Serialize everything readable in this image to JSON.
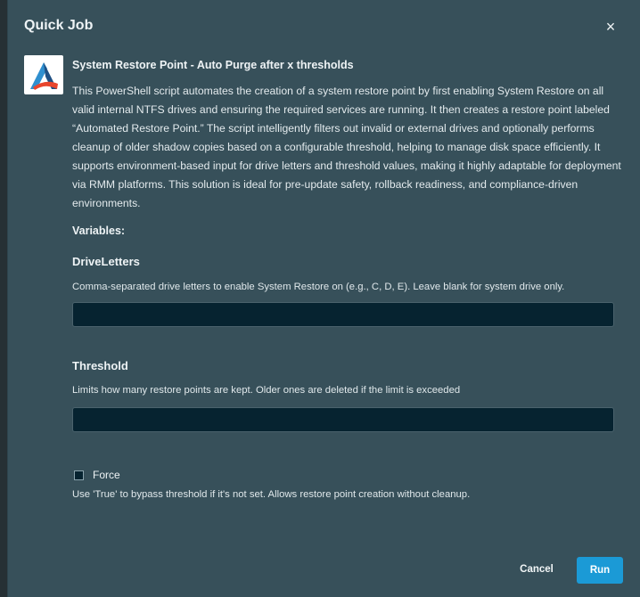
{
  "dialog": {
    "title": "Quick Job",
    "close_icon": "×"
  },
  "script": {
    "logo_icon": "ninjaone-logo",
    "title": "System Restore Point - Auto Purge after x thresholds",
    "description": "This PowerShell script automates the creation of a system restore point by first enabling System Restore on all valid internal NTFS drives and ensuring the required services are running. It then creates a restore point labeled “Automated Restore Point.” The script intelligently filters out invalid or external drives and optionally performs cleanup of older shadow copies based on a configurable threshold, helping to manage disk space efficiently. It supports environment-based input for drive letters and threshold values, making it highly adaptable for deployment via RMM platforms. This solution is ideal for pre-update safety, rollback readiness, and compliance-driven environments."
  },
  "variables": {
    "heading": "Variables:",
    "drive_letters": {
      "label": "DriveLetters",
      "help": "Comma-separated drive letters to enable System Restore on (e.g., C, D, E). Leave blank for system drive only.",
      "value": ""
    },
    "threshold": {
      "label": "Threshold",
      "help": "Limits how many restore points are kept. Older ones are deleted if the limit is exceeded",
      "value": ""
    },
    "force": {
      "label": "Force",
      "checked": false,
      "help": "Use 'True' to bypass threshold if it's not set. Allows restore point creation without cleanup."
    }
  },
  "footer": {
    "cancel_label": "Cancel",
    "run_label": "Run"
  },
  "colors": {
    "dialog_bg": "#37505a",
    "input_bg": "#062330",
    "accent": "#1b9ad6"
  }
}
